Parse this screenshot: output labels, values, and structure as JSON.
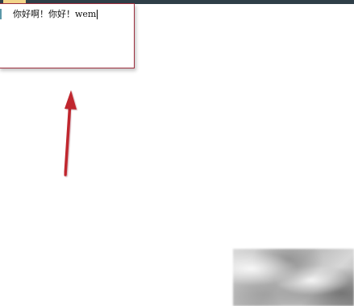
{
  "editor": {
    "text": "你好啊！你好！wem"
  },
  "annotation": {
    "arrow_color": "#c0282d"
  }
}
